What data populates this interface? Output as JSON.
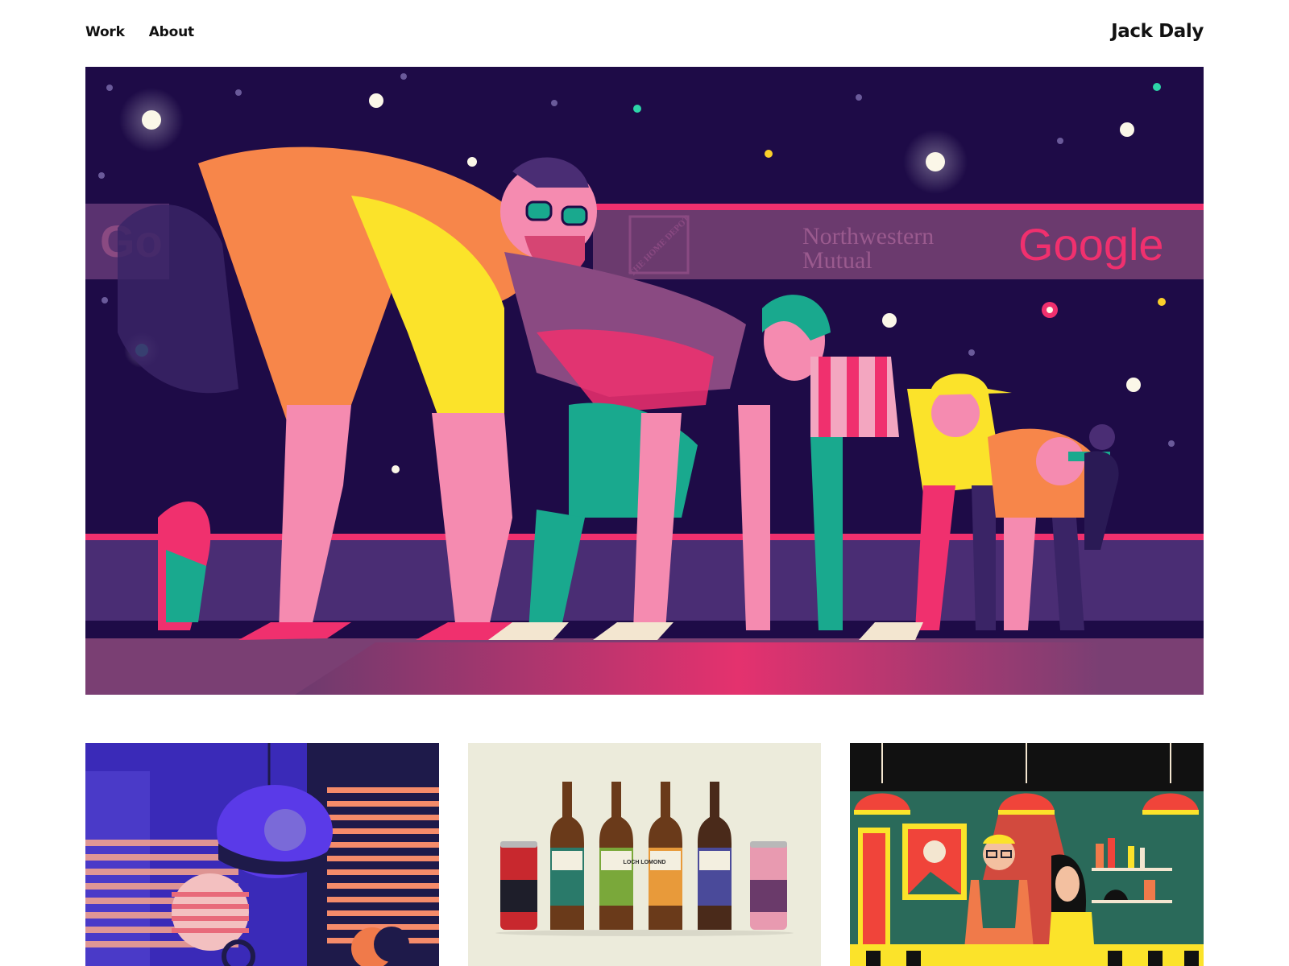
{
  "header": {
    "nav": [
      {
        "label": "Work"
      },
      {
        "label": "About"
      }
    ],
    "site_title": "Jack Daly"
  },
  "hero": {
    "banner_logos": [
      "Go",
      "THE HOME DEPOT",
      "Northwestern",
      "Mutual",
      "Google"
    ]
  },
  "thumbnails": [
    {
      "subject": "night window lamp illustration"
    },
    {
      "subject": "Loch Lomond brewery bottles",
      "label": "LOCH LOMOND"
    },
    {
      "subject": "bar interior illustration"
    }
  ],
  "colors": {
    "night_sky": "#1e0b47",
    "banner": "#6b3a6e",
    "pink": "#f0306e",
    "orange": "#f7864a",
    "yellow": "#fbe32a",
    "teal": "#19a98e",
    "purple": "#4a2d74"
  }
}
